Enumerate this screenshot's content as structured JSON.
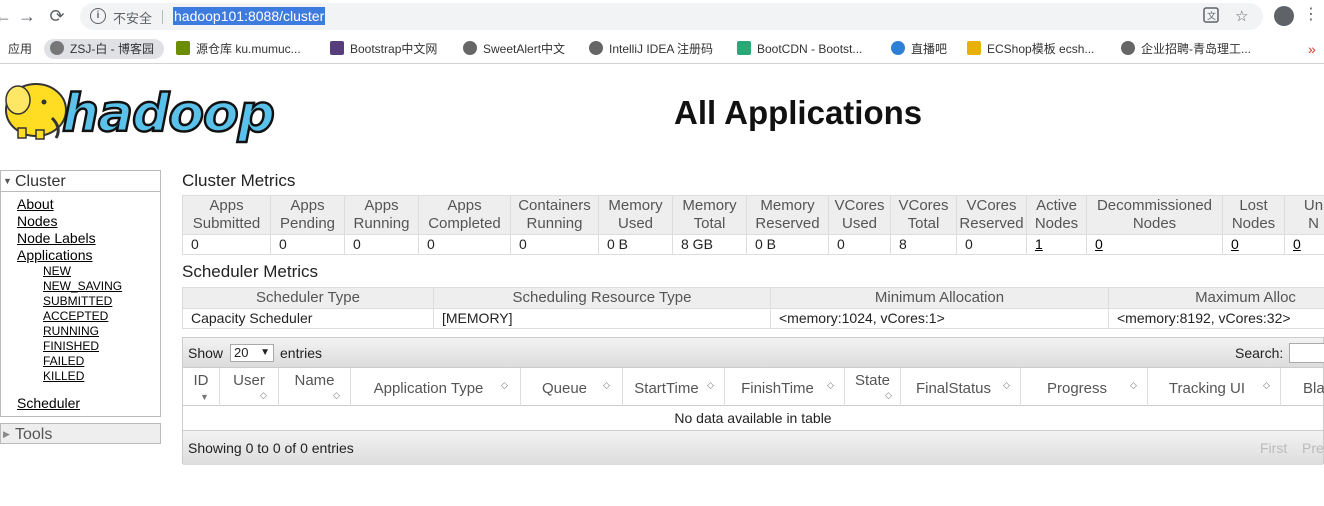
{
  "browser": {
    "insecure_label": "不安全",
    "url": "hadoop101:8088/cluster",
    "bookmarks": [
      {
        "label": "应用",
        "icon": "apps-grid-icon"
      },
      {
        "label": "ZSJ-白 - 博客园",
        "icon": "cnblogs-icon"
      },
      {
        "label": "源仓库 ku.mumuc...",
        "icon": "m-logo-icon",
        "color": "#6a8e00"
      },
      {
        "label": "Bootstrap中文网",
        "icon": "bootstrap-icon",
        "color": "#563d7c"
      },
      {
        "label": "SweetAlert中文",
        "icon": "globe-icon"
      },
      {
        "label": "IntelliJ IDEA 注册码",
        "icon": "globe-icon"
      },
      {
        "label": "BootCDN - Bootst...",
        "icon": "bootcdn-icon",
        "color": "#2aa876"
      },
      {
        "label": "直播吧",
        "icon": "zhibo8-icon",
        "color": "#2e7fd6"
      },
      {
        "label": "ECShop模板 ecsh...",
        "icon": "ecshop-icon",
        "color": "#e7b10a"
      },
      {
        "label": "企业招聘-青岛理工...",
        "icon": "globe-icon"
      }
    ]
  },
  "page": {
    "title": "All Applications",
    "logo_text": "hadoop"
  },
  "sidebar": {
    "cluster": {
      "heading": "Cluster",
      "links": [
        "About",
        "Nodes",
        "Node Labels",
        "Applications"
      ],
      "app_states": [
        "NEW",
        "NEW_SAVING",
        "SUBMITTED",
        "ACCEPTED",
        "RUNNING",
        "FINISHED",
        "FAILED",
        "KILLED"
      ],
      "scheduler": "Scheduler"
    },
    "tools": "Tools"
  },
  "cluster_metrics": {
    "title": "Cluster Metrics",
    "headers": [
      [
        "Apps",
        "Submitted"
      ],
      [
        "Apps",
        "Pending"
      ],
      [
        "Apps",
        "Running"
      ],
      [
        "Apps",
        "Completed"
      ],
      [
        "Containers",
        "Running"
      ],
      [
        "Memory",
        "Used"
      ],
      [
        "Memory",
        "Total"
      ],
      [
        "Memory",
        "Reserved"
      ],
      [
        "VCores",
        "Used"
      ],
      [
        "VCores",
        "Total"
      ],
      [
        "VCores",
        "Reserved"
      ],
      [
        "Active",
        "Nodes"
      ],
      [
        "Decommissioned",
        "Nodes"
      ],
      [
        "Lost",
        "Nodes"
      ],
      [
        "Un",
        "N"
      ]
    ],
    "values": [
      "0",
      "0",
      "0",
      "0",
      "0",
      "0 B",
      "8 GB",
      "0 B",
      "0",
      "8",
      "0",
      "1",
      "0",
      "0",
      "0"
    ]
  },
  "scheduler_metrics": {
    "title": "Scheduler Metrics",
    "headers": [
      "Scheduler Type",
      "Scheduling Resource Type",
      "Minimum Allocation",
      "Maximum Alloc"
    ],
    "values": [
      "Capacity Scheduler",
      "[MEMORY]",
      "<memory:1024, vCores:1>",
      "<memory:8192, vCores:32>"
    ]
  },
  "apps_table": {
    "show_label": "Show",
    "page_length": "20",
    "entries_label": "entries",
    "search_label": "Search:",
    "columns": [
      "ID",
      "User",
      "Name",
      "Application Type",
      "Queue",
      "StartTime",
      "FinishTime",
      "State",
      "FinalStatus",
      "Progress",
      "Tracking UI",
      "Bla"
    ],
    "empty_message": "No data available in table",
    "info": "Showing 0 to 0 of 0 entries",
    "first_label": "First",
    "previous_label": "Pre"
  }
}
